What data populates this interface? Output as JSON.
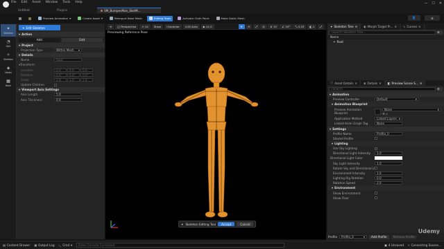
{
  "menu": {
    "items": [
      "File",
      "Edit",
      "Asset",
      "Window",
      "Tools",
      "Help"
    ],
    "project": "Untitled",
    "plugins_label": "Plugins"
  },
  "doc_tab": {
    "label": "SM_BumpesMan_SkelM..."
  },
  "toolbar": {
    "items": [
      "Preview Animation",
      "Create Asset",
      "Reimport Base Mesh",
      "Editing Tools",
      "Activate Cloth Paint",
      "Make Static Mesh"
    ]
  },
  "rail": {
    "items": [
      "Skeleton",
      "Skin",
      "Skeleton",
      "Model",
      "Mesh"
    ]
  },
  "left": {
    "title": "Edit Skeleton",
    "action_section": "Action",
    "tabs": [
      "Add",
      "Edit"
    ],
    "project_section": "Project",
    "projection_label": "Projection Type",
    "projection_value": "Within Mesh",
    "details_section": "Details",
    "name_label": "Name",
    "name_value": "Root",
    "transform_section": "Transform",
    "location_label": "Location",
    "location_vals": [
      "0.0",
      "0.0",
      "0.0"
    ],
    "rotation_label": "Rotation",
    "rotation_vals": [
      "0.0°",
      "0.0°",
      "0.0°"
    ],
    "scale_label": "Scale",
    "scale_vals": [
      "1.0",
      "1.0",
      "1.0"
    ],
    "update_children_label": "Update Children",
    "viewport_section": "Viewport Axis Settings",
    "axis_length_label": "Axis Length",
    "axis_length_value": "5.0",
    "axis_thickness_label": "Axis Thickness",
    "axis_thickness_value": "0.0"
  },
  "viewport": {
    "tools": [
      "Perspective",
      "Lit",
      "Show",
      "Character",
      "LOD Auto",
      "x1.0"
    ],
    "right_tools": [
      "10",
      "10°",
      "0.25",
      "1"
    ],
    "overlay": "Previewing Reference Pose",
    "skeleton_tool_label": "Skeleton Editing Tool",
    "accept": "Accept",
    "cancel": "Cancel"
  },
  "right": {
    "tabs_top": [
      "Skeleton Tree",
      "Morph Target Pr...",
      "Curves"
    ],
    "search_placeholder": "Search Skeleton Tree...",
    "tree_header": "Name",
    "tree_items": [
      "Root"
    ],
    "tabs_mid": [
      "Asset Details",
      "Details",
      "Preview Scene S..."
    ],
    "search2_placeholder": "Search",
    "animation_section": "Animation",
    "preview_controller_label": "Preview Controller",
    "preview_controller_value": "Default",
    "animation_blueprint_section": "Animation Blueprint",
    "preview_anim_bp_label": "Preview Animation Blueprint",
    "preview_anim_bp_value": "None",
    "application_method_label": "Application Method",
    "application_method_value": "Linked Layers",
    "linked_graph_tag_label": "Linked Anim Graph Tag",
    "linked_graph_tag_value": "None",
    "settings_section": "Settings",
    "profile_name_label": "Profile Name",
    "profile_name_value": "Profile_0",
    "shared_profile_label": "Shared Profile",
    "lighting_section": "Lighting",
    "use_sky_lighting_label": "Use Sky Lighting",
    "dir_light_intensity_label": "Directional Light Intensity",
    "dir_light_intensity_value": "1.0",
    "dir_light_color_label": "Directional Light Color",
    "sky_light_intensity_label": "Sky Light Intensity",
    "sky_light_intensity_value": "1.0",
    "rotate_sky_label": "Rotate Sky and Directional Ligh...",
    "env_intensity_label": "Environment Intensity",
    "env_intensity_value": "1.0",
    "lighting_rig_label": "Lighting Rig Rotation",
    "lighting_rig_value": "0.0",
    "rotation_speed_label": "Rotation Speed",
    "rotation_speed_value": "2.0",
    "environment_section": "Environment",
    "show_environment_label": "Show Environment",
    "show_floor_label": "Show Floor",
    "profile_bar_label": "Profile",
    "profile_bar_value": "Profile_0",
    "add_profile": "Add Profile",
    "remove_profile": "Remove Profile"
  },
  "status": {
    "items": [
      "Content Drawer",
      "Output Log",
      "Cmd"
    ],
    "console_placeholder": "Enter Console Command",
    "unsaved": "4 Unsaved",
    "source_control": "Connecting Source...",
    "watermark": "Udemy"
  },
  "colors": {
    "accent": "#2f7ad6",
    "character": "#e3932e",
    "select_blue": "#2f4f79"
  }
}
